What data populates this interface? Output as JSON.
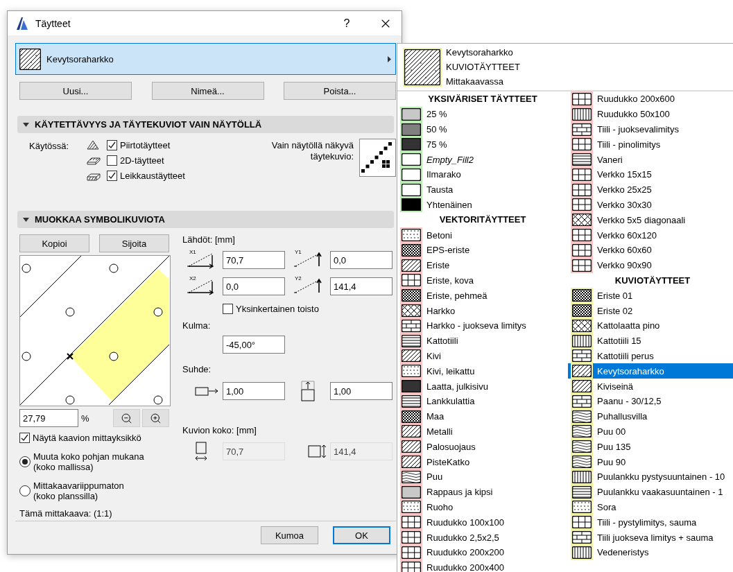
{
  "window": {
    "title": "Täytteet",
    "help": "?"
  },
  "selector": {
    "name": "Kevytsoraharkko"
  },
  "actions": [
    "Uusi...",
    "Nimeä...",
    "Poista..."
  ],
  "availability": {
    "title": "KÄYTETTÄVYYS JA TÄYTEKUVIOT VAIN NÄYTÖLLÄ",
    "expanded": true,
    "label": "Käytössä:",
    "options": [
      {
        "label": "Piirtotäytteet",
        "checked": true
      },
      {
        "label": "2D-täytteet",
        "checked": false
      },
      {
        "label": "Leikkaustäytteet",
        "checked": true
      }
    ],
    "screen_only_label": "Vain näytöllä näkyvä täytekuvio:"
  },
  "symbol": {
    "title": "MUOKKAA SYMBOLIKUVIOTA",
    "expanded": true,
    "buttons": [
      "Kopioi",
      "Sijoita"
    ],
    "zoom": "27,79",
    "zoom_unit": "%",
    "show_unit": {
      "label": "Näytä kaavion mittayksikkö",
      "checked": true
    },
    "scale_options": [
      {
        "label": "Muuta koko pohjan mukana",
        "note": "(koko mallissa)",
        "selected": true
      },
      {
        "label": "Mittakaavariippumaton",
        "note": "(koko planssilla)",
        "selected": false
      }
    ],
    "current_scale": "Tämä mittakaava: (1:1)",
    "offsets_label": "Lähdöt: [mm]",
    "offsets": [
      {
        "axis": "X1",
        "value": "70,7"
      },
      {
        "axis": "Y1",
        "value": "0,0"
      },
      {
        "axis": "X2",
        "value": "0,0"
      },
      {
        "axis": "Y2",
        "value": "141,4"
      }
    ],
    "simple_repeat": {
      "label": "Yksinkertainen toisto",
      "checked": false
    },
    "angle_label": "Kulma:",
    "angle": "-45,00°",
    "ratio_label": "Suhde:",
    "ratio": [
      "1,00",
      "1,00"
    ],
    "size_label": "Kuvion koko: [mm]",
    "size": [
      "70,7",
      "141,4"
    ]
  },
  "footer": {
    "buttons": [
      {
        "label": "Kumoa",
        "default": false
      },
      {
        "label": "OK",
        "default": true
      }
    ]
  },
  "popup": {
    "current": [
      "Kevytsoraharkko",
      "KUVIOTÄYTTEET",
      "Mittakaavassa"
    ],
    "columns": [
      {
        "sections": [
          {
            "heading": "YKSIVÄRISET TÄYTTEET",
            "color": "#b8ecb0",
            "items": [
              {
                "label": "25 %",
                "selected": false,
                "italic": false
              },
              {
                "label": "50 %",
                "selected": false,
                "italic": false
              },
              {
                "label": "75 %",
                "selected": false,
                "italic": false
              },
              {
                "label": "Empty_Fill2",
                "selected": false,
                "italic": true
              },
              {
                "label": "Ilmarako",
                "selected": false,
                "italic": false
              },
              {
                "label": "Tausta",
                "selected": false,
                "italic": false
              },
              {
                "label": "Yhtenäinen",
                "selected": false,
                "italic": false
              }
            ]
          },
          {
            "heading": "VEKTORITÄYTTEET",
            "color": "#f8c4c4",
            "items": [
              {
                "label": "Betoni",
                "selected": false
              },
              {
                "label": "EPS-eriste",
                "selected": false
              },
              {
                "label": "Eriste",
                "selected": false
              },
              {
                "label": "Eriste, kova",
                "selected": false
              },
              {
                "label": "Eriste, pehmeä",
                "selected": false
              },
              {
                "label": "Harkko",
                "selected": false
              },
              {
                "label": "Harkko - juokseva limitys",
                "selected": false
              },
              {
                "label": "Kattotiili",
                "selected": false
              },
              {
                "label": "Kivi",
                "selected": false
              },
              {
                "label": "Kivi, leikattu",
                "selected": false
              },
              {
                "label": "Laatta, julkisivu",
                "selected": false
              },
              {
                "label": "Lankkulattia",
                "selected": false
              },
              {
                "label": "Maa",
                "selected": false
              },
              {
                "label": "Metalli",
                "selected": false
              },
              {
                "label": "Palosuojaus",
                "selected": false
              },
              {
                "label": "PisteKatko",
                "selected": false
              },
              {
                "label": "Puu",
                "selected": false
              },
              {
                "label": "Rappaus ja kipsi",
                "selected": false
              },
              {
                "label": "Ruoho",
                "selected": false
              },
              {
                "label": "Ruudukko 100x100",
                "selected": false
              },
              {
                "label": "Ruudukko 2,5x2,5",
                "selected": false
              },
              {
                "label": "Ruudukko 200x200",
                "selected": false
              },
              {
                "label": "Ruudukko 200x400",
                "selected": false
              }
            ]
          }
        ]
      },
      {
        "sections": [
          {
            "color": "#f8c4c4",
            "items": [
              {
                "label": "Ruudukko 200x600",
                "selected": false
              },
              {
                "label": "Ruudukko 50x100",
                "selected": false
              },
              {
                "label": "Tiili - juoksevalimitys",
                "selected": false
              },
              {
                "label": "Tiili - pinolimitys",
                "selected": false
              },
              {
                "label": "Vaneri",
                "selected": false
              },
              {
                "label": "Verkko 15x15",
                "selected": false
              },
              {
                "label": "Verkko 25x25",
                "selected": false
              },
              {
                "label": "Verkko 30x30",
                "selected": false
              },
              {
                "label": "Verkko 5x5 diagonaali",
                "selected": false
              },
              {
                "label": "Verkko 60x120",
                "selected": false
              },
              {
                "label": "Verkko 60x60",
                "selected": false
              },
              {
                "label": "Verkko 90x90",
                "selected": false
              }
            ]
          },
          {
            "heading": "KUVIOTÄYTTEET",
            "color": "#eef0a0",
            "items": [
              {
                "label": "Eriste 01",
                "selected": false
              },
              {
                "label": "Eriste 02",
                "selected": false
              },
              {
                "label": "Kattolaatta pino",
                "selected": false
              },
              {
                "label": "Kattotiili 15",
                "selected": false
              },
              {
                "label": "Kattotiili perus",
                "selected": false
              },
              {
                "label": "Kevytsoraharkko",
                "selected": true
              },
              {
                "label": "Kiviseinä",
                "selected": false
              },
              {
                "label": "Paanu - 30/12,5",
                "selected": false
              },
              {
                "label": "Puhallusvilla",
                "selected": false
              },
              {
                "label": "Puu 00",
                "selected": false
              },
              {
                "label": "Puu 135",
                "selected": false
              },
              {
                "label": "Puu 90",
                "selected": false
              },
              {
                "label": "Puulankku pystysuuntainen - 10",
                "selected": false
              },
              {
                "label": "Puulankku vaakasuuntainen - 1",
                "selected": false
              },
              {
                "label": "Sora",
                "selected": false
              },
              {
                "label": "Tiili - pystylimitys, sauma",
                "selected": false
              },
              {
                "label": "Tiili juokseva limitys + sauma",
                "selected": false
              },
              {
                "label": "Vedeneristys",
                "selected": false
              }
            ]
          }
        ]
      }
    ]
  }
}
